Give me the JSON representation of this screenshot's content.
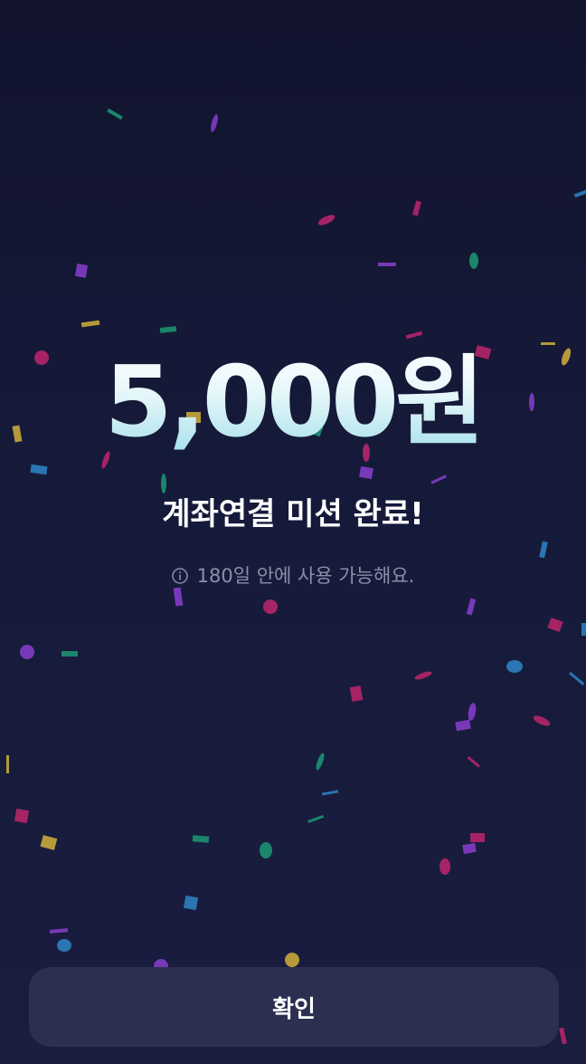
{
  "reward": {
    "amount": "5,000원",
    "message": "계좌연결 미션 완료!",
    "notice": "180일 안에 사용 가능해요."
  },
  "icons": {
    "notice_icon": "info-icon",
    "background_effect": "confetti"
  },
  "actions": {
    "confirm_label": "확인"
  },
  "colors": {
    "background": "#161a3a",
    "amount_gradient_top": "#ffffff",
    "amount_gradient_bottom": "#9fdde8",
    "button_background": "#2c2f4f",
    "notice_text": "#8c8fa8",
    "confetti": [
      "#c0266e",
      "#8a3fd0",
      "#d4b13a",
      "#2f86c8",
      "#1d9a74"
    ]
  }
}
